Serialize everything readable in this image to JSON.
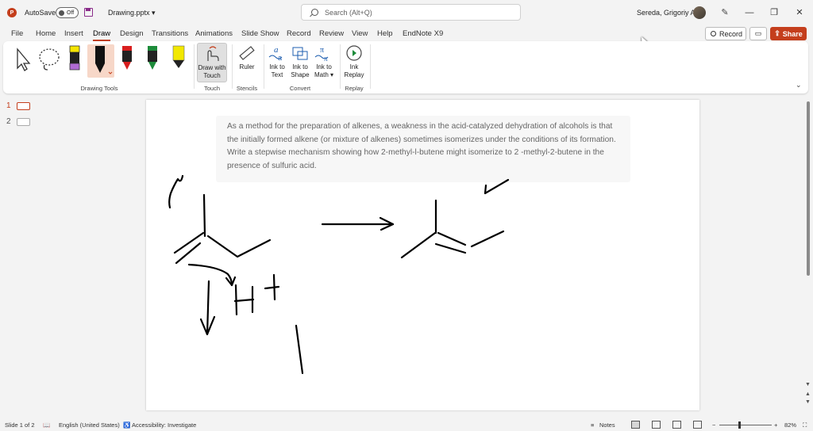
{
  "titlebar": {
    "app_logo": "P",
    "autosave_label": "AutoSave",
    "autosave_state": "Off",
    "filename": "Drawing.pptx",
    "filename_chevron": "▾",
    "search_placeholder": "Search (Alt+Q)",
    "username": "Sereda, Grigoriy A",
    "window_controls": [
      "—",
      "❐",
      "✕"
    ]
  },
  "menu": {
    "tabs": [
      "File",
      "Home",
      "Insert",
      "Draw",
      "Design",
      "Transitions",
      "Animations",
      "Slide Show",
      "Record",
      "Review",
      "View",
      "Help",
      "EndNote X9"
    ],
    "active_tab": "Draw",
    "record_label": "Record",
    "share_label": "Share"
  },
  "ribbon": {
    "groups": {
      "drawing_tools": "Drawing Tools",
      "touch": "Touch",
      "stencils": "Stencils",
      "convert": "Convert",
      "replay": "Replay"
    },
    "buttons": {
      "draw_with_touch": [
        "Draw with",
        "Touch"
      ],
      "ruler": "Ruler",
      "ink_to_text": [
        "Ink to",
        "Text"
      ],
      "ink_to_shape": [
        "Ink to",
        "Shape"
      ],
      "ink_to_math": [
        "Ink to",
        "Math ▾"
      ],
      "ink_replay": [
        "Ink",
        "Replay"
      ]
    },
    "pen_colors": {
      "highlighter_yellow_1": "#f5e500",
      "pen_black": "#111111",
      "pen_red": "#d81e1e",
      "pen_green": "#1d8b3a",
      "highlighter_yellow_2": "#f2e800",
      "accent": "#c43e1c"
    }
  },
  "thumbnails": {
    "slides": [
      "1",
      "2"
    ],
    "active": "1"
  },
  "slide": {
    "question_text": "As a method for the preparation of alkenes, a weakness in the acid-catalyzed dehydration of alcohols is that the initially formed alkene (or mixture of alkenes) sometimes isomerizes under the conditions of its formation. Write a stepwise mechanism showing how 2-methyl-l-butene might isomerize to 2 -methyl-2-butene in the presence of sulfuric acid.",
    "ink_text_h_plus": "H+"
  },
  "statusbar": {
    "slide_info": "Slide 1 of 2",
    "language": "English (United States)",
    "accessibility": "Accessibility: Investigate",
    "notes": "Notes",
    "zoom": "82%"
  }
}
